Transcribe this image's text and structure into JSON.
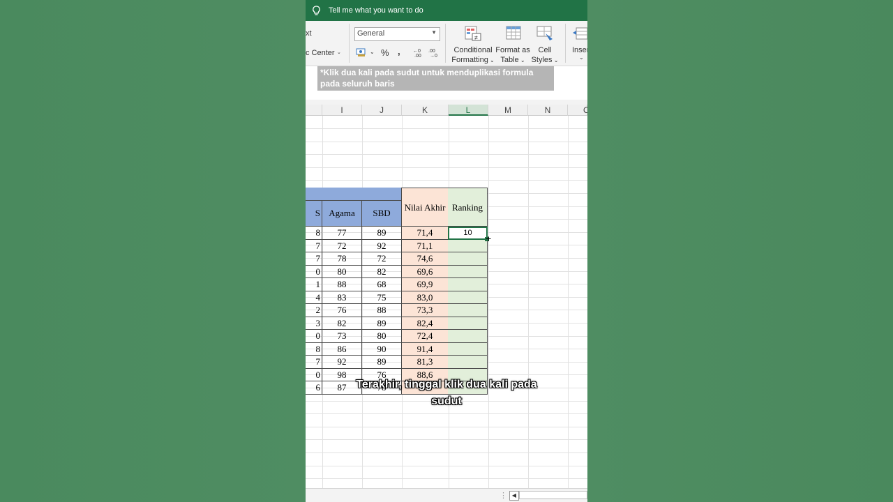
{
  "search_bar": {
    "placeholder": "Tell me what you want to do"
  },
  "ribbon": {
    "wrap_text_partial": "xt",
    "merge_center_partial": "c Center",
    "number_format": "General",
    "percent_glyph": "%",
    "comma_glyph": ",",
    "conditional_formatting": [
      "Conditional",
      "Formatting"
    ],
    "format_as_table": [
      "Format as",
      "Table"
    ],
    "cell_styles": [
      "Cell",
      "Styles"
    ],
    "insert_partial": "Inser"
  },
  "tooltip": "*Klik dua kali pada sudut untuk menduplikasi formula pada seluruh baris",
  "columns": [
    "I",
    "J",
    "K",
    "L",
    "M",
    "N",
    "O"
  ],
  "selected_column": "L",
  "table": {
    "headers": {
      "h_partial": "S",
      "agama": "Agama",
      "sbd": "SBD",
      "nilai_akhir": "Nilai Akhir",
      "ranking": "Ranking"
    },
    "rows": [
      {
        "h": "8",
        "agama": "77",
        "sbd": "89",
        "nilai": "71,4",
        "rank": "10"
      },
      {
        "h": "7",
        "agama": "72",
        "sbd": "92",
        "nilai": "71,1",
        "rank": ""
      },
      {
        "h": "7",
        "agama": "78",
        "sbd": "72",
        "nilai": "74,6",
        "rank": ""
      },
      {
        "h": "0",
        "agama": "80",
        "sbd": "82",
        "nilai": "69,6",
        "rank": ""
      },
      {
        "h": "1",
        "agama": "88",
        "sbd": "68",
        "nilai": "69,9",
        "rank": ""
      },
      {
        "h": "4",
        "agama": "83",
        "sbd": "75",
        "nilai": "83,0",
        "rank": ""
      },
      {
        "h": "2",
        "agama": "76",
        "sbd": "88",
        "nilai": "73,3",
        "rank": ""
      },
      {
        "h": "3",
        "agama": "82",
        "sbd": "89",
        "nilai": "82,4",
        "rank": ""
      },
      {
        "h": "0",
        "agama": "73",
        "sbd": "80",
        "nilai": "72,4",
        "rank": ""
      },
      {
        "h": "8",
        "agama": "86",
        "sbd": "90",
        "nilai": "91,4",
        "rank": ""
      },
      {
        "h": "7",
        "agama": "92",
        "sbd": "89",
        "nilai": "81,3",
        "rank": ""
      },
      {
        "h": "0",
        "agama": "98",
        "sbd": "76",
        "nilai": "88,6",
        "rank": ""
      },
      {
        "h": "6",
        "agama": "87",
        "sbd": "78",
        "nilai": "",
        "rank": ""
      }
    ]
  },
  "caption": [
    "Terakhir, tinggal klik dua kali pada",
    "sudut"
  ],
  "colors": {
    "excel_green": "#217346",
    "header_blue": "#8eaadb",
    "peach": "#fce4d6",
    "light_green": "#e2efda"
  }
}
